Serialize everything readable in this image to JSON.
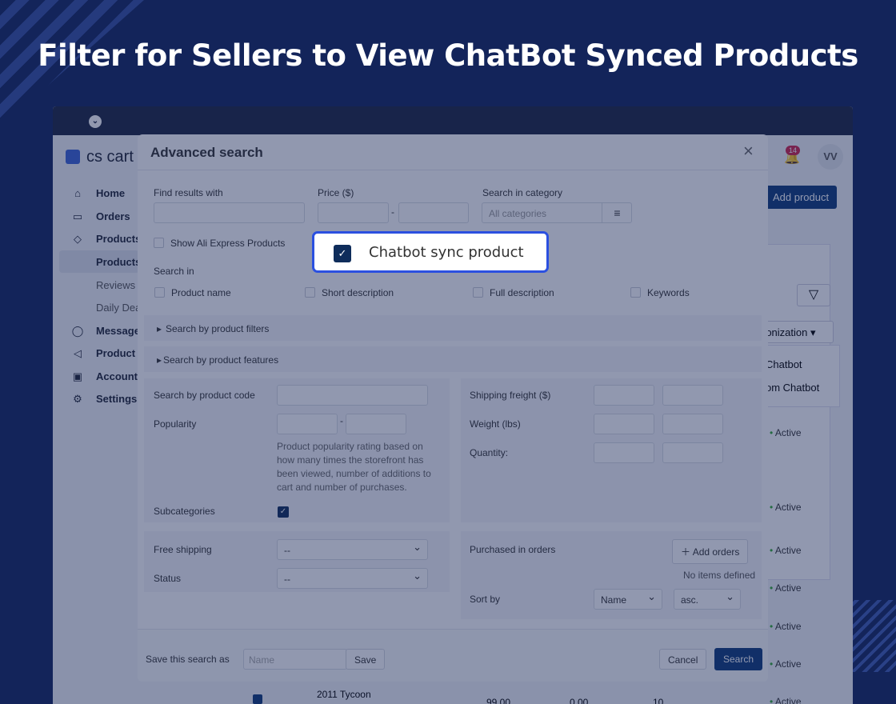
{
  "headline": "Filter for Sellers to View ChatBot Synced Products",
  "app": {
    "logo": "cs cart",
    "notifications_count": "14",
    "avatar": "VV",
    "add_product": "Add product",
    "sync_dropdown": "ronization",
    "sync_menu": [
      "Chatbot",
      "om Chatbot"
    ],
    "sidebar": [
      {
        "label": "Home",
        "icon": "home-icon"
      },
      {
        "label": "Orders",
        "icon": "inbox-icon"
      },
      {
        "label": "Products",
        "icon": "tag-icon"
      },
      {
        "label": "Products",
        "sub": true,
        "active": true
      },
      {
        "label": "Reviews",
        "sub": true
      },
      {
        "label": "Daily Dea",
        "sub": true
      },
      {
        "label": "Message",
        "icon": "chat-icon"
      },
      {
        "label": "Product I",
        "icon": "megaphone-icon"
      },
      {
        "label": "Accounti",
        "icon": "wallet-icon"
      },
      {
        "label": "Settings",
        "icon": "gear-icon"
      }
    ],
    "status_rows": [
      "Active",
      "Active",
      "Active",
      "Active",
      "Active",
      "Active",
      "Active"
    ],
    "product_row": {
      "name": "2011 Tycoon",
      "price": "99.00",
      "list": "0.00",
      "qty": "10"
    }
  },
  "modal": {
    "title": "Advanced search",
    "find_label": "Find results with",
    "price_label": "Price ($)",
    "category_label": "Search in category",
    "category_placeholder": "All categories",
    "ali_label": "Show Ali Express Products",
    "chatbot_label": "Chatbot sync product",
    "search_in": "Search in",
    "search_in_opts": [
      "Product name",
      "Short description",
      "Full description",
      "Keywords"
    ],
    "filters": "Search by product filters",
    "features": "Search by product features",
    "code_label": "Search by product code",
    "popularity_label": "Popularity",
    "popularity_help": "Product popularity rating based on how many times the storefront has been viewed, number of additions to cart and number of purchases.",
    "shipping_label": "Shipping freight ($)",
    "weight_label": "Weight (lbs)",
    "quantity_label": "Quantity:",
    "subcategories_label": "Subcategories",
    "free_shipping_label": "Free shipping",
    "free_shipping_value": "--",
    "status_label": "Status",
    "status_value": "--",
    "purchased_label": "Purchased in orders",
    "add_orders": "Add orders",
    "no_items": "No items defined",
    "sort_label": "Sort by",
    "sort_field": "Name",
    "sort_dir": "asc.",
    "save_as_label": "Save this search as",
    "name_placeholder": "Name",
    "save": "Save",
    "cancel": "Cancel",
    "search": "Search"
  }
}
